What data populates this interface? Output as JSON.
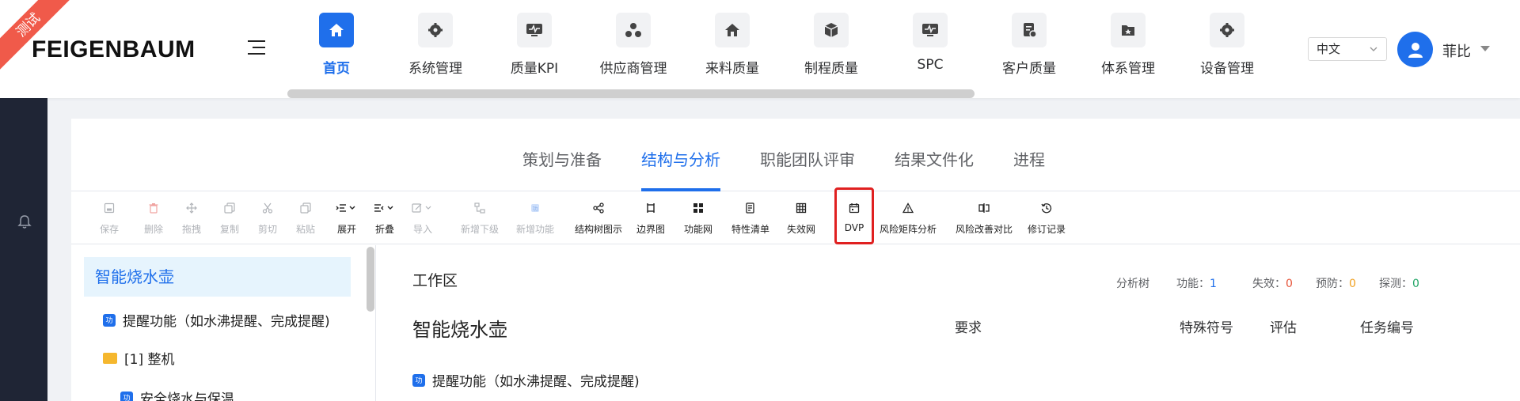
{
  "ribbon": "测试",
  "brand": "FEIGENBAUM",
  "nav": [
    {
      "label": "首页",
      "icon": "home-icon",
      "active": true
    },
    {
      "label": "系统管理",
      "icon": "gear-icon"
    },
    {
      "label": "质量KPI",
      "icon": "monitor-pulse-icon"
    },
    {
      "label": "供应商管理",
      "icon": "cluster-icon"
    },
    {
      "label": "来料质量",
      "icon": "house-icon"
    },
    {
      "label": "制程质量",
      "icon": "cube-icon"
    },
    {
      "label": "SPC",
      "icon": "monitor-pulse-icon"
    },
    {
      "label": "客户质量",
      "icon": "document-user-icon"
    },
    {
      "label": "体系管理",
      "icon": "star-folder-icon"
    },
    {
      "label": "设备管理",
      "icon": "gear-icon"
    }
  ],
  "language": {
    "value": "中文"
  },
  "user": {
    "name": "菲比"
  },
  "tabs": [
    {
      "label": "策划与准备"
    },
    {
      "label": "结构与分析",
      "active": true
    },
    {
      "label": "职能团队评审"
    },
    {
      "label": "结果文件化"
    },
    {
      "label": "进程"
    }
  ],
  "toolbar": [
    {
      "label": "保存",
      "icon": "save-icon",
      "disabled": true
    },
    {
      "label": "删除",
      "icon": "trash-icon",
      "disabled": true
    },
    {
      "label": "拖拽",
      "icon": "move-icon",
      "disabled": true
    },
    {
      "label": "复制",
      "icon": "copy-icon",
      "disabled": true
    },
    {
      "label": "剪切",
      "icon": "scissors-icon",
      "disabled": true
    },
    {
      "label": "粘贴",
      "icon": "paste-icon",
      "disabled": true
    },
    {
      "label": "展开",
      "icon": "expand-icon"
    },
    {
      "label": "折叠",
      "icon": "collapse-icon"
    },
    {
      "label": "导入",
      "icon": "import-icon",
      "disabled": true
    },
    {
      "label": "新增下级",
      "icon": "add-child-icon",
      "disabled": true
    },
    {
      "label": "新增功能",
      "icon": "add-function-icon",
      "disabled": true
    },
    {
      "label": "结构树图示",
      "icon": "share-tree-icon"
    },
    {
      "label": "边界图",
      "icon": "boundary-icon"
    },
    {
      "label": "功能网",
      "icon": "grid-icon"
    },
    {
      "label": "特性清单",
      "icon": "list-doc-icon"
    },
    {
      "label": "失效网",
      "icon": "net-icon"
    },
    {
      "label": "DVP",
      "icon": "calendar-icon",
      "highlighted": true
    },
    {
      "label": "风险矩阵分析",
      "icon": "warning-icon"
    },
    {
      "label": "风险改善对比",
      "icon": "compare-icon"
    },
    {
      "label": "修订记录",
      "icon": "history-icon"
    }
  ],
  "tree": {
    "root": "智能烧水壶",
    "items": [
      {
        "label": "提醒功能（如水沸提醒、完成提醒)",
        "type": "function",
        "badge": "功"
      },
      {
        "label": "[1] 整机",
        "type": "folder"
      },
      {
        "label": "安全烧水与保温",
        "type": "function",
        "badge": "功"
      }
    ]
  },
  "workspace": {
    "title": "工作区",
    "stats": {
      "tree_label": "分析树",
      "function_label": "功能：",
      "function_value": "1",
      "failure_label": "失效：",
      "failure_value": "0",
      "prevention_label": "预防：",
      "prevention_value": "0",
      "detection_label": "探测：",
      "detection_value": "0"
    },
    "name": "智能烧水壶",
    "columns": [
      "要求",
      "特殊符号",
      "评估",
      "任务编号"
    ],
    "function_row": {
      "badge": "功",
      "label": "提醒功能（如水沸提醒、完成提醒)"
    }
  },
  "colors": {
    "accent": "#1f6feb",
    "highlight_border": "#e02020",
    "failure": "#e6553a",
    "prevention": "#f0a020",
    "detection": "#21a566"
  }
}
